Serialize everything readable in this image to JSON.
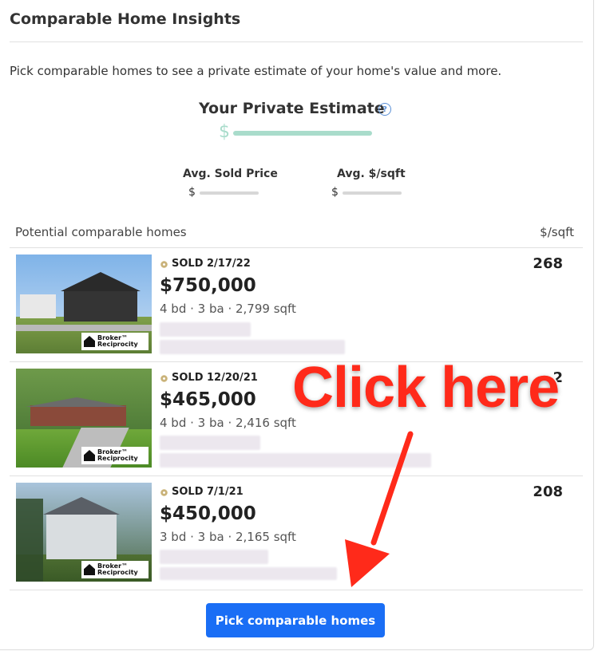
{
  "panel": {
    "title": "Comparable Home Insights",
    "intro": "Pick comparable homes to see a private estimate of your home's value and more."
  },
  "estimate": {
    "title": "Your Private Estimate",
    "help_icon": "question-circle-icon",
    "currency": "$"
  },
  "stats": [
    {
      "label": "Avg. Sold Price",
      "currency": "$"
    },
    {
      "label": "Avg. $/sqft",
      "currency": "$"
    }
  ],
  "list": {
    "header_left": "Potential comparable homes",
    "header_right": "$/sqft"
  },
  "homes": [
    {
      "status": "SOLD 2/17/22",
      "price": "$750,000",
      "specs": "4 bd · 3 ba · 2,799 sqft",
      "ppsf": "268"
    },
    {
      "status": "SOLD 12/20/21",
      "price": "$465,000",
      "specs": "4 bd · 3 ba · 2,416 sqft",
      "ppsf": "2"
    },
    {
      "status": "SOLD 7/1/21",
      "price": "$450,000",
      "specs": "3 bd · 3 ba · 2,165 sqft",
      "ppsf": "208"
    }
  ],
  "broker_badge": {
    "line1": "Broker™",
    "line2": "Reciprocity"
  },
  "button": {
    "label": "Pick comparable homes"
  },
  "annotation": {
    "text": "Click here",
    "color": "#ff2a1a"
  },
  "colors": {
    "accent": "#1a6ef5",
    "estimate": "#a9dccb"
  }
}
